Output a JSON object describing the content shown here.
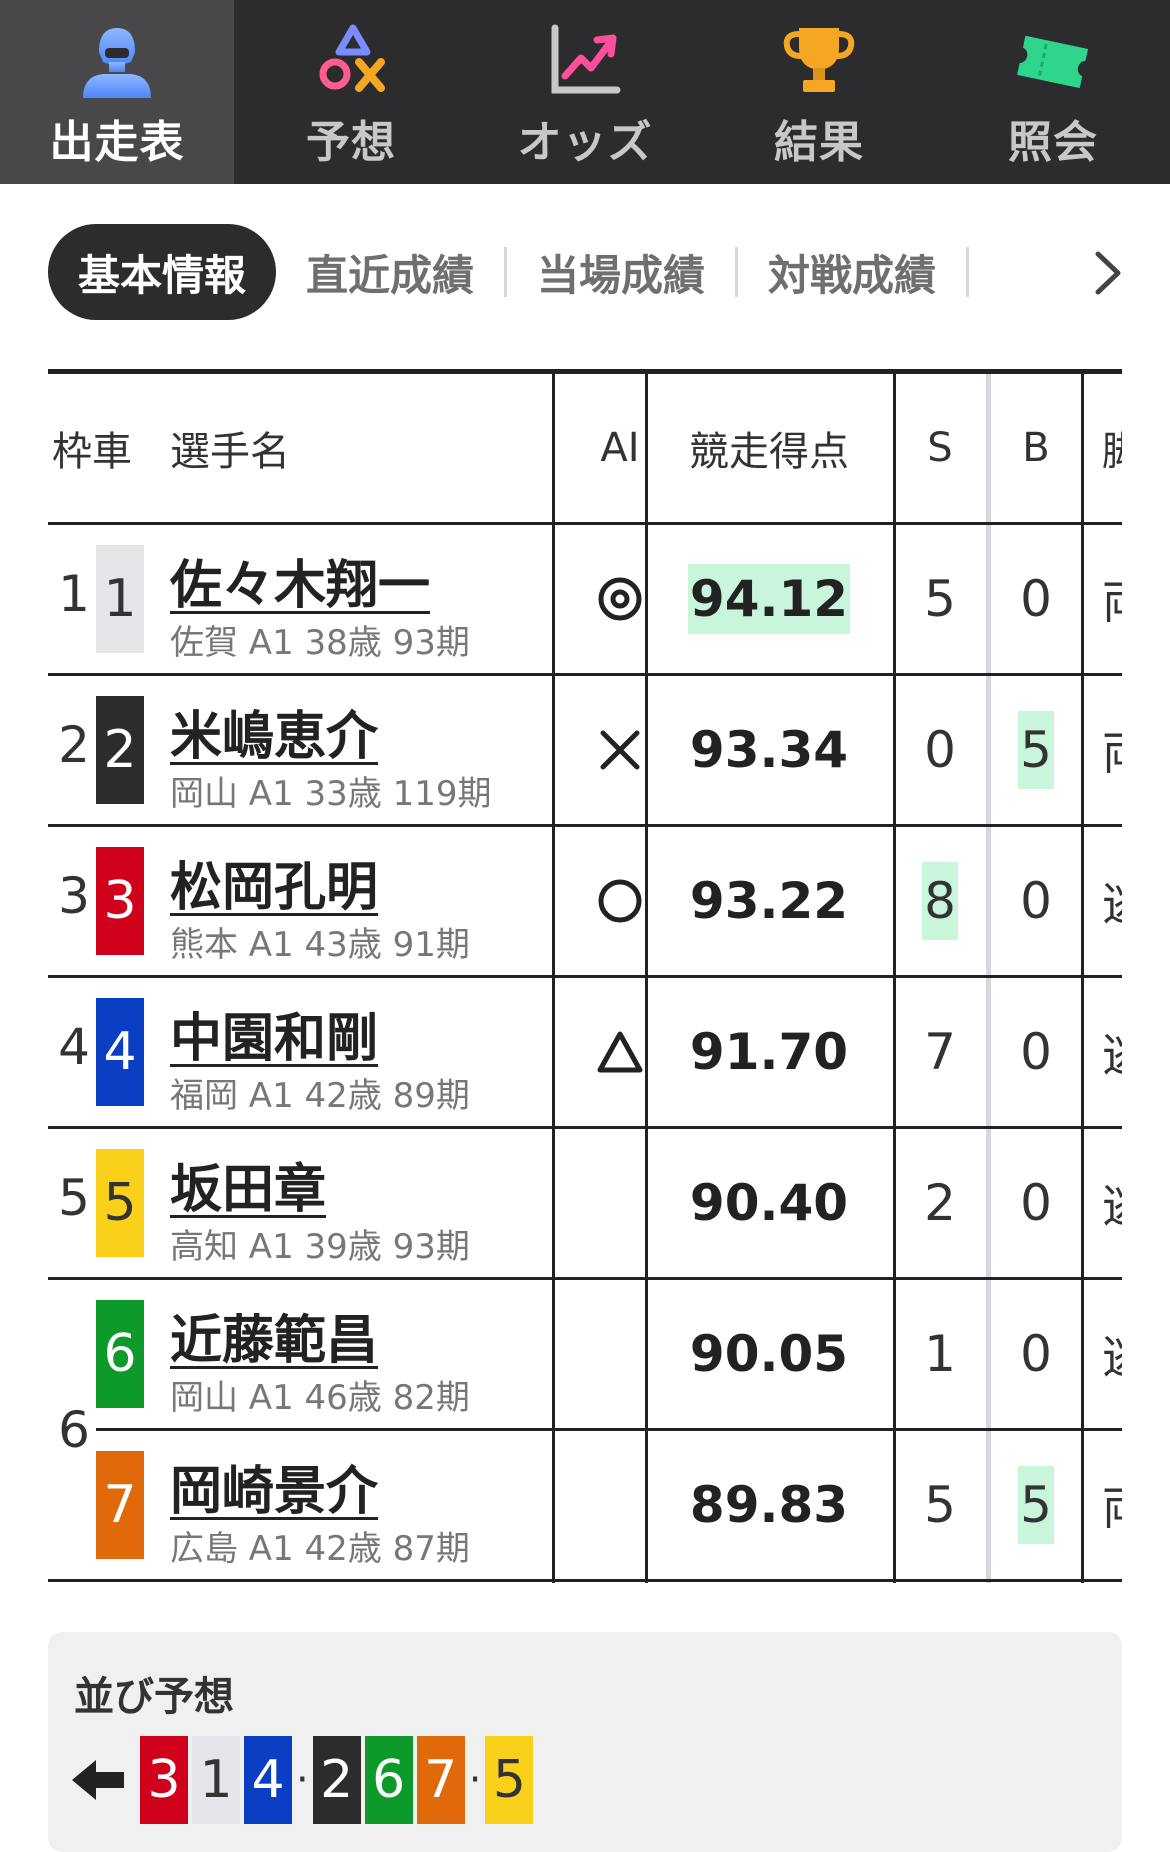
{
  "nav": {
    "items": [
      {
        "label": "出走表",
        "icon": "rider-icon",
        "active": true
      },
      {
        "label": "予想",
        "icon": "prediction-icon",
        "active": false
      },
      {
        "label": "オッズ",
        "icon": "odds-chart-icon",
        "active": false
      },
      {
        "label": "結果",
        "icon": "trophy-icon",
        "active": false
      },
      {
        "label": "照会",
        "icon": "ticket-icon",
        "active": false
      }
    ]
  },
  "subtabs": {
    "active": "基本情報",
    "items": [
      "直近成績",
      "当場成績",
      "対戦成績"
    ],
    "more_icon": "chevron-right-icon"
  },
  "table": {
    "headers": {
      "frame_car": "枠車",
      "player": "選手名",
      "ai": "AI",
      "score": "競走得点",
      "s": "S",
      "b": "B",
      "leg": "脚"
    },
    "rows": [
      {
        "frame": "1",
        "car": "1",
        "name": "佐々木翔一",
        "info": "佐賀 A1 38歳 93期",
        "ai": "double-circle",
        "score": "94.12",
        "score_hl": true,
        "s": "5",
        "s_hl": false,
        "b": "0",
        "b_hl": false,
        "leg": "両"
      },
      {
        "frame": "2",
        "car": "2",
        "name": "米嶋恵介",
        "info": "岡山 A1 33歳 119期",
        "ai": "cross",
        "score": "93.34",
        "score_hl": false,
        "s": "0",
        "s_hl": false,
        "b": "5",
        "b_hl": true,
        "leg": "両"
      },
      {
        "frame": "3",
        "car": "3",
        "name": "松岡孔明",
        "info": "熊本 A1 43歳 91期",
        "ai": "circle",
        "score": "93.22",
        "score_hl": false,
        "s": "8",
        "s_hl": true,
        "b": "0",
        "b_hl": false,
        "leg": "逃"
      },
      {
        "frame": "4",
        "car": "4",
        "name": "中園和剛",
        "info": "福岡 A1 42歳 89期",
        "ai": "triangle",
        "score": "91.70",
        "score_hl": false,
        "s": "7",
        "s_hl": false,
        "b": "0",
        "b_hl": false,
        "leg": "逃"
      },
      {
        "frame": "5",
        "car": "5",
        "name": "坂田章",
        "info": "高知 A1 39歳 93期",
        "ai": "",
        "score": "90.40",
        "score_hl": false,
        "s": "2",
        "s_hl": false,
        "b": "0",
        "b_hl": false,
        "leg": "逃"
      },
      {
        "frame": "6",
        "car": "6",
        "name": "近藤範昌",
        "info": "岡山 A1 46歳 82期",
        "ai": "",
        "score": "90.05",
        "score_hl": false,
        "s": "1",
        "s_hl": false,
        "b": "0",
        "b_hl": false,
        "leg": "逃"
      },
      {
        "frame": "",
        "car": "7",
        "name": "岡崎景介",
        "info": "広島 A1 42歳 87期",
        "ai": "",
        "score": "89.83",
        "score_hl": false,
        "s": "5",
        "s_hl": false,
        "b": "5",
        "b_hl": true,
        "leg": "両"
      }
    ]
  },
  "car_colors": {
    "1": {
      "bg": "#e6e6ea",
      "fg": "#333333"
    },
    "2": {
      "bg": "#2c2c2e",
      "fg": "#ffffff"
    },
    "3": {
      "bg": "#d0021b",
      "fg": "#ffffff"
    },
    "4": {
      "bg": "#0a3fc4",
      "fg": "#ffffff"
    },
    "5": {
      "bg": "#f9d11b",
      "fg": "#333333"
    },
    "6": {
      "bg": "#0d9a2a",
      "fg": "#ffffff"
    },
    "7": {
      "bg": "#e06a0a",
      "fg": "#ffffff"
    }
  },
  "line_prediction": {
    "title": "並び予想",
    "arrow_icon": "arrow-left-icon",
    "groups": [
      [
        "3",
        "1",
        "4"
      ],
      [
        "2",
        "6",
        "7"
      ],
      [
        "5"
      ]
    ]
  }
}
